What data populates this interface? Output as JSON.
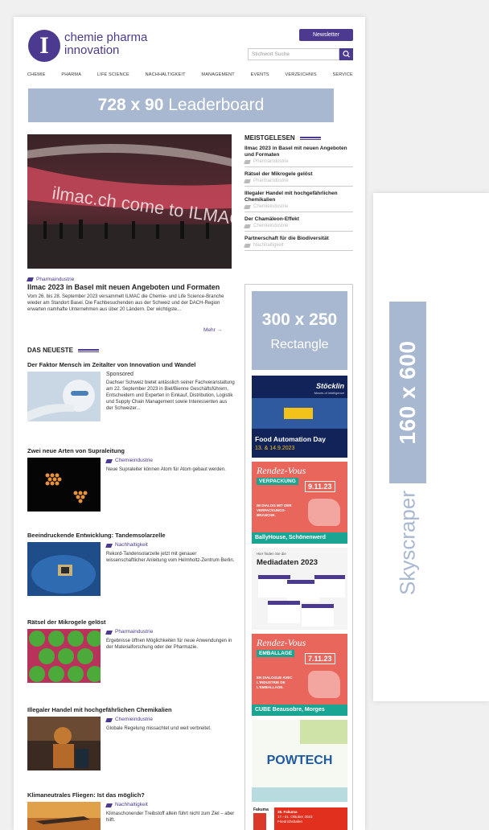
{
  "site": {
    "logo_letter": "I",
    "logo_line1": "chemie pharma",
    "logo_line2": "innovation",
    "newsletter_label": "Newsletter",
    "search_placeholder": "Stichwort Suche",
    "nav": [
      "CHEMIE",
      "PHARMA",
      "LIFE SCIENCE",
      "NACHHALTIGKEIT",
      "MANAGEMENT",
      "EVENTS",
      "VERZEICHNIS",
      "SERVICE"
    ]
  },
  "ads": {
    "leaderboard_size": "728 x 90",
    "leaderboard_label": "Leaderboard",
    "rectangle_size": "300 x 250",
    "rectangle_label": "Rectangle",
    "skyscraper_size": "160 x 600",
    "skyscraper_label": "Skyscraper",
    "food": {
      "brand": "Stöcklin",
      "tagline": "Moves of intelligence",
      "title": "Food Automation Day",
      "dates": "13. & 14.9.2023"
    },
    "rv1": {
      "title": "Rendez-Vous",
      "badge": "VERPACKUNG",
      "date": "9.11.23",
      "text": "IM DIALOG MIT DER VERPACKUNGS-BRANCHE.",
      "footer": "BallyHouse, Schönenwerd"
    },
    "media": {
      "label": "Hier finden Sie die",
      "title": "Mediadaten 2023"
    },
    "rv2": {
      "title": "Rendez-Vous",
      "badge": "EMBALLAGE",
      "date": "7.11.23",
      "text": "EN DIALOGUE AVEC L'INDUSTRIE DE L'EMBALLAGE.",
      "footer": "CUBE Beausobre, Morges"
    },
    "powtech": {
      "title": "POWTECH"
    },
    "fakuma": {
      "logo": "Fakuma",
      "line1": "28. Fakuma",
      "line2": "17.–21. Oktober 2023",
      "line3": "Friedrichshafen"
    }
  },
  "hero": {
    "category": "Pharmaindustrie",
    "title": "Ilmac 2023 in Basel mit neuen Angeboten und Formaten",
    "text": "Vom 26. bis 28. September 2023 versammelt ILMAC die Chemie- und Life Science-Branche wieder am Standort Basel. Die Fachbesuchenden aus der Schweiz und der DACH-Region erwarten namhafte Unternehmen aus über 20 Ländern. Der wichtigste...",
    "more": "Mehr →",
    "image_text": "ilmac.ch   come to ILMAC | M"
  },
  "latest": {
    "heading": "DAS NEUESTE",
    "articles": [
      {
        "title": "Der Faktor Mensch im Zeitalter von Innovation und Wandel",
        "sponsored": "Sponsored",
        "text": "Dachser Schweiz bietet anlässlich seiner Fachveranstaltung am 22. September 2023 in Biel/Bienne Geschäftsführern, Entscheidern und Experten in Einkauf, Distribution, Logistik und Supply Chain Management sowie Interessenten aus der Schweizer..."
      },
      {
        "title": "Zwei neue Arten von Supraleitung",
        "category": "Chemieindustrie",
        "text": "Neue Supraleiter können Atom für Atom gebaut werden."
      },
      {
        "title": "Beeindruckende Entwicklung: Tandemsolarzelle",
        "category": "Nachhaltigkeit",
        "text": "Rekord-Tandensolarzelle jetzt mit genauer wissenschaftlicher Anleitung vom Helmholtz-Zentrum Berlin."
      },
      {
        "title": "Rätsel der Mikrogele gelöst",
        "category": "Pharmaindustrie",
        "text": "Ergebnisse öffnen Möglichkeiten für neue Anwendungen in der Materialforschung oder der Pharmazie."
      },
      {
        "title": "Illegaler Handel mit hochgefährlichen Chemikalien",
        "category": "Chemieindustrie",
        "text": "Globale Regelung missachtet und weit verbreitet."
      },
      {
        "title": "Klimaneutrales Fliegen: Ist das möglich?",
        "category": "Nachhaltigkeit",
        "text": "Klimaschonender Treibstoff allein führt nicht zum Ziel – aber hilft."
      }
    ]
  },
  "most_read": {
    "heading": "MEISTGELESEN",
    "items": [
      {
        "title": "Ilmac 2023 in Basel mit neuen Angeboten und Formaten",
        "category": "Pharmaindustrie"
      },
      {
        "title": "Rätsel der Mikrogele gelöst",
        "category": "Pharmaindustrie"
      },
      {
        "title": "Illegaler Handel mit hochgefährlichen Chemikalien",
        "category": "Chemieindustrie"
      },
      {
        "title": "Der Chamäleon-Effekt",
        "category": "Chemieindustrie"
      },
      {
        "title": "Partnerschaft für die Biodiversität",
        "category": "Nachhaltigkeit"
      }
    ]
  },
  "colors": {
    "brand": "#4b3a8f",
    "ad_placeholder": "#a9b8d1",
    "rendezvous": "#e8665c",
    "ad_teal": "#1aa593"
  }
}
